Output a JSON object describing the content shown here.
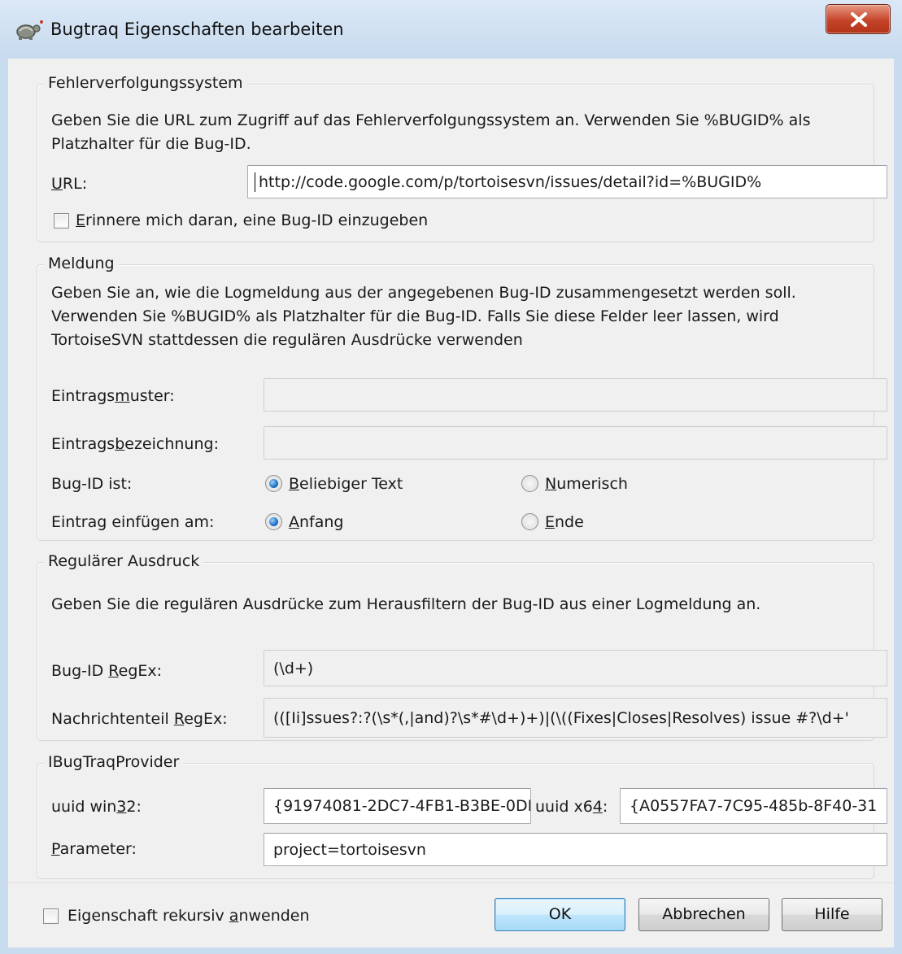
{
  "window": {
    "title": "Bugtraq Eigenschaften bearbeiten"
  },
  "bugtracker": {
    "legend": "Fehlerverfolgungssystem",
    "description_line1": "Geben Sie die URL zum Zugriff auf das Fehlerverfolgungssystem an. Verwenden Sie %BUGID% als",
    "description_line2": "Platzhalter für die Bug-ID.",
    "url_label_hotkey": "U",
    "url_label_rest": "RL:",
    "url_value": "http://code.google.com/p/tortoisesvn/issues/detail?id=%BUGID%",
    "remind_label_hotkey": "E",
    "remind_label_rest": "rinnere mich daran, eine Bug-ID einzugeben"
  },
  "message": {
    "legend": "Meldung",
    "description_line1": "Geben Sie an, wie die Logmeldung aus der angegebenen Bug-ID zusammengesetzt werden soll.",
    "description_line2": "Verwenden Sie %BUGID% als Platzhalter für die Bug-ID. Falls Sie diese Felder leer lassen, wird",
    "description_line3": "TortoiseSVN stattdessen die regulären Ausdrücke verwenden",
    "pattern_label_a": "Eintrags",
    "pattern_label_hotkey": "m",
    "pattern_label_b": "uster:",
    "pattern_value": "",
    "label_label_a": "Eintrags",
    "label_label_hotkey": "b",
    "label_label_b": "ezeichnung:",
    "label_value": "",
    "bugid_label": "Bug-ID ist:",
    "option_text_hotkey": "B",
    "option_text_rest": "eliebiger Text",
    "option_numeric_hotkey": "N",
    "option_numeric_rest": "umerisch",
    "insert_label": "Eintrag einfügen am:",
    "option_start_hotkey": "A",
    "option_start_rest": "nfang",
    "option_end_hotkey": "E",
    "option_end_rest": "nde",
    "bugid_selected": "Beliebiger Text",
    "insert_selected": "Anfang"
  },
  "regex": {
    "legend": "Regulärer Ausdruck",
    "description": "Geben Sie die regulären Ausdrücke zum Herausfiltern der Bug-ID aus einer Logmeldung an.",
    "bugid_label_a": "Bug-ID ",
    "bugid_label_hotkey": "R",
    "bugid_label_b": "egEx:",
    "bugid_value": "(\\d+)",
    "message_label_a": "Nachrichtenteil ",
    "message_label_hotkey": "R",
    "message_label_b": "egEx:",
    "message_value": "(([Ii]ssues?:?(\\s*(,|and)?\\s*#\\d+)+)|(\\((Fixes|Closes|Resolves) issue #?\\d+'"
  },
  "provider": {
    "legend": "IBugTraqProvider",
    "win32_label_a": "uuid win",
    "win32_label_hotkey": "3",
    "win32_label_b": "2:",
    "win32_value": "{91974081-2DC7-4FB1-B3BE-0DE",
    "x64_label_a": "uuid x6",
    "x64_label_hotkey": "4",
    "x64_label_b": ":",
    "x64_value": "{A0557FA7-7C95-485b-8F40-31",
    "param_label_hotkey": "P",
    "param_label_rest": "arameter:",
    "param_value": "project=tortoisesvn"
  },
  "footer": {
    "recursive_label_a": "Eigenschaft rekursiv ",
    "recursive_label_hotkey": "a",
    "recursive_label_b": "nwenden",
    "ok_label": "OK",
    "cancel_label": "Abbrechen",
    "help_label": "Hilfe"
  },
  "colors": {
    "frame": "#c9dbee",
    "client": "#f0f0f0",
    "close_button": "#c4432a",
    "default_button_border": "#3c7fb1"
  },
  "icons": {
    "app": "tortoise-icon",
    "close": "close-icon"
  }
}
